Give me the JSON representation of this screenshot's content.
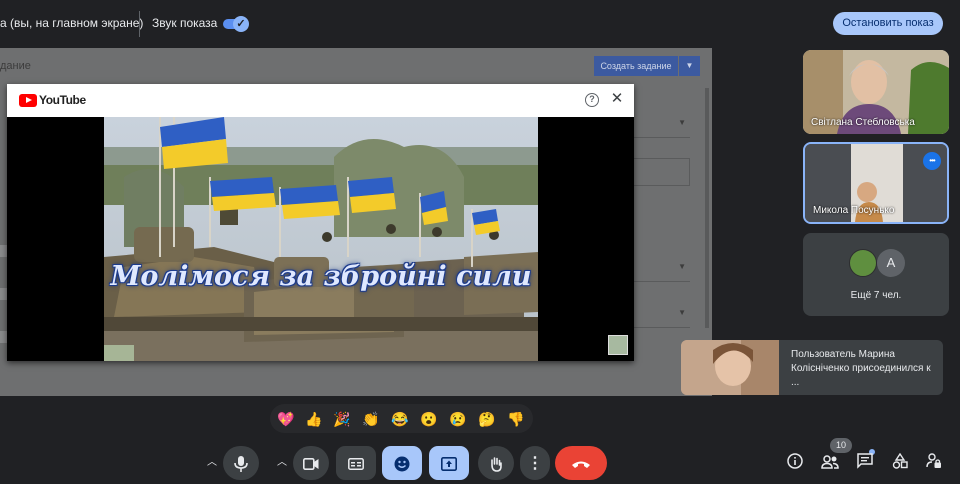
{
  "topbar": {
    "presenting_text": "а (вы, на главном экране)",
    "sound_label": "Звук показа",
    "sound_enabled": true,
    "stop_button": "Остановить показ"
  },
  "shared_screen": {
    "page_title": "дание",
    "create_button": "Создать задание",
    "popup": {
      "brand": "YouTube",
      "video_caption": "Молімося за збройні сили"
    }
  },
  "participants": {
    "tiles": [
      {
        "name": "Світлана Стебловська"
      },
      {
        "name": "Микола Посунько",
        "speaking": true
      },
      {
        "more_label": "Ещё 7 чел.",
        "avatar_letter": "A"
      }
    ]
  },
  "toast": {
    "message": "Пользователь Марина Колісніченко присоединился к ..."
  },
  "reactions": [
    {
      "icon": "sparkling-heart-icon",
      "glyph": "💖"
    },
    {
      "icon": "thumbs-up-icon",
      "glyph": "👍"
    },
    {
      "icon": "party-popper-icon",
      "glyph": "🎉"
    },
    {
      "icon": "clapping-hands-icon",
      "glyph": "👏"
    },
    {
      "icon": "laughing-face-icon",
      "glyph": "😂"
    },
    {
      "icon": "surprised-face-icon",
      "glyph": "😮"
    },
    {
      "icon": "sad-face-icon",
      "glyph": "😢"
    },
    {
      "icon": "thinking-face-icon",
      "glyph": "🤔"
    },
    {
      "icon": "thumbs-down-icon",
      "glyph": "👎"
    }
  ],
  "controls": {
    "participants_count": "10",
    "colors": {
      "accent": "#a8c7fa",
      "hangup": "#ea4335",
      "background": "#202124",
      "control": "#3c4043"
    }
  }
}
